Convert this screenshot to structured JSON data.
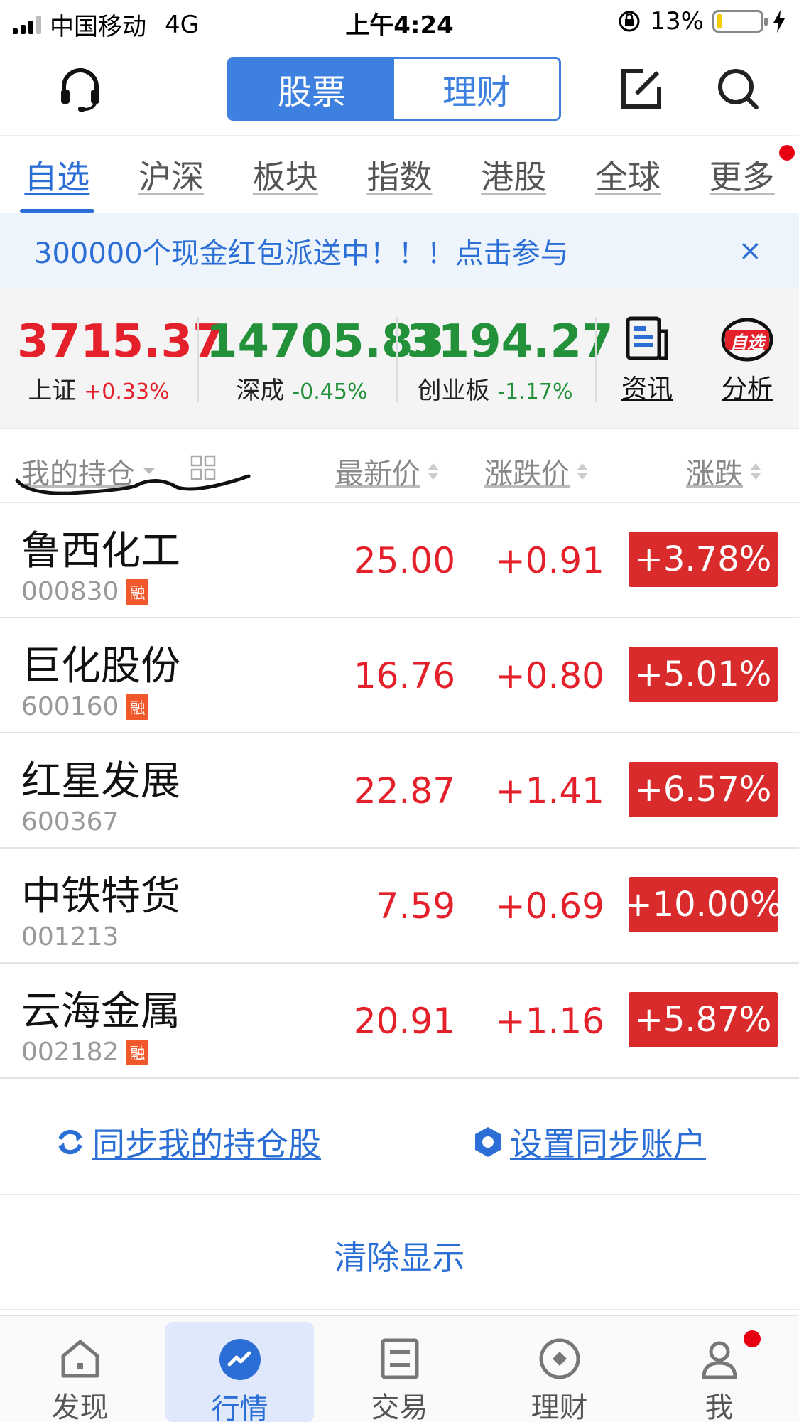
{
  "status_bar": {
    "carrier": "中国移动",
    "network": "4G",
    "time": "上午4:24",
    "battery_text": "13%",
    "battery_level": 0.13
  },
  "top_nav": {
    "segment_stock": "股票",
    "segment_finance": "理财"
  },
  "tabs": [
    {
      "label": "自选"
    },
    {
      "label": "沪深"
    },
    {
      "label": "板块"
    },
    {
      "label": "指数"
    },
    {
      "label": "港股"
    },
    {
      "label": "全球"
    },
    {
      "label": "更多"
    }
  ],
  "banner": {
    "text": "300000个现金红包派送中！！！点击参与",
    "close": "×"
  },
  "indices": [
    {
      "value": "3715.37",
      "name": "上证",
      "change": "+0.33%"
    },
    {
      "value": "14705.83",
      "name": "深成",
      "change": "-0.45%"
    },
    {
      "value": "3194.27",
      "name": "创业板",
      "change": "-1.17%"
    }
  ],
  "quick_buttons": {
    "news": "资讯",
    "analysis": "分析",
    "analysis_badge": "自选"
  },
  "list_header": {
    "holdings": "我的持仓",
    "latest": "最新价",
    "change_price": "涨跌价",
    "change_pct": "涨跌"
  },
  "stocks": [
    {
      "name": "鲁西化工",
      "code": "000830",
      "rong": "融",
      "price": "25.00",
      "chg": "+0.91",
      "pct": "+3.78%"
    },
    {
      "name": "巨化股份",
      "code": "600160",
      "rong": "融",
      "price": "16.76",
      "chg": "+0.80",
      "pct": "+5.01%"
    },
    {
      "name": "红星发展",
      "code": "600367",
      "rong": "",
      "price": "22.87",
      "chg": "+1.41",
      "pct": "+6.57%"
    },
    {
      "name": "中铁特货",
      "code": "001213",
      "rong": "",
      "price": "7.59",
      "chg": "+0.69",
      "pct": "+10.00%"
    },
    {
      "name": "云海金属",
      "code": "002182",
      "rong": "融",
      "price": "20.91",
      "chg": "+1.16",
      "pct": "+5.87%"
    }
  ],
  "actions": {
    "sync_holdings": "同步我的持仓股",
    "set_sync_account": "设置同步账户",
    "clear_display": "清除显示"
  },
  "bottom_tabs": [
    {
      "label": "发现"
    },
    {
      "label": "行情"
    },
    {
      "label": "交易"
    },
    {
      "label": "理财"
    },
    {
      "label": "我"
    }
  ],
  "colors": {
    "accent": "#2b6fd6",
    "up": "#e4202b",
    "down": "#22913a",
    "badge": "#d92b2b"
  }
}
